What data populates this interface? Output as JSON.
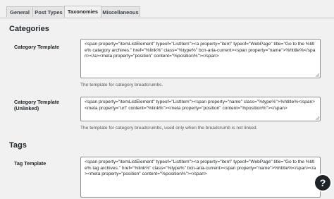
{
  "tabs": [
    {
      "label": "General",
      "active": false
    },
    {
      "label": "Post Types",
      "active": false
    },
    {
      "label": "Taxonomies",
      "active": true
    },
    {
      "label": "Miscellaneous",
      "active": false
    }
  ],
  "categories": {
    "heading": "Categories",
    "template": {
      "label": "Category Template",
      "value": "<span property=\"itemListElement\" typeof=\"ListItem\"><a property=\"item\" typeof=\"WebPage\" title=\"Go to the %title% category archives.\" href=\"%link%\" class=\"%type%\" bcn-aria-current><span property=\"name\">%htitle%</span></a><meta property=\"position\" content=\"%position%\"></span>",
      "description": "The template for category breadcrumbs."
    },
    "template_unlinked": {
      "label": "Category Template (Unlinked)",
      "value": "<span property=\"itemListElement\" typeof=\"ListItem\"><span property=\"name\" class=\"%type%\">%htitle%</span><meta property=\"url\" content=\"%link%\"><meta property=\"position\" content=\"%position%\"></span>",
      "description": "The template for category breadcrumbs, used only when the breadcrumb is not linked."
    }
  },
  "tags": {
    "heading": "Tags",
    "template": {
      "label": "Tag Template",
      "value": "<span property=\"itemListElement\" typeof=\"ListItem\"><a property=\"item\" typeof=\"WebPage\" title=\"Go to the %title% tag archives.\" href=\"%link%\" class=\"%type%\" bcn-aria-current><span property=\"name\">%htitle%</span></a><meta property=\"position\" content=\"%position%\"></span>"
    }
  },
  "help": {
    "label": "?"
  },
  "icons": {
    "help": "question-mark-icon",
    "resize": "resize-grip-icon"
  }
}
